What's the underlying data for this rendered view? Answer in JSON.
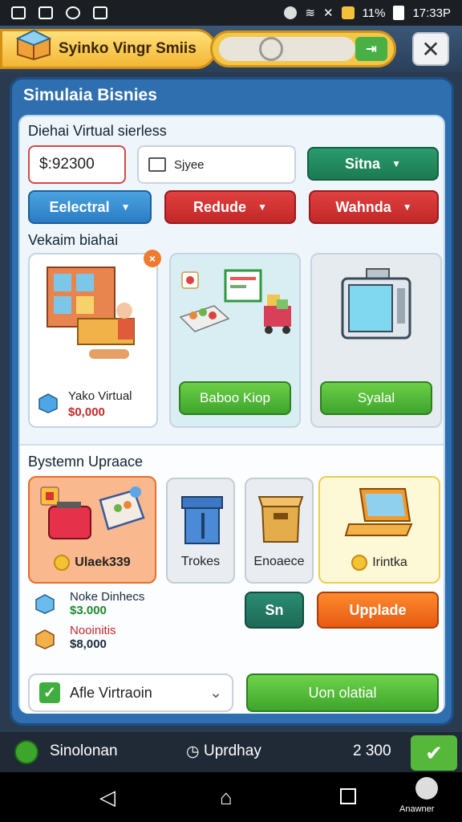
{
  "status_bar": {
    "battery": "11%",
    "time": "17:33P"
  },
  "header": {
    "title": "Syinko Vingr Smiis",
    "close_label": "✕"
  },
  "panel": {
    "title": "Simulaia Bisnies",
    "section1_label": "Diehai Virtual sierless",
    "price_field": "$:92300",
    "search_field": "Sjyee",
    "dropdown_primary": "Sitna",
    "dropdown_blue": "Eelectral",
    "dropdown_red1": "Redude",
    "dropdown_red2": "Wahnda",
    "section2_label": "Vekaim biahai",
    "cards": [
      {
        "name": "Yako Virtual",
        "price": "$0,000"
      },
      {
        "button": "Baboo Kiop"
      },
      {
        "button": "Syalal"
      }
    ],
    "section3_label": "Bystemn Upraace",
    "tiles": [
      {
        "label": "Ulaek339"
      },
      {
        "label": "Trokes"
      },
      {
        "label": "Enoaece"
      },
      {
        "label": "Irintka"
      }
    ],
    "list": [
      {
        "name": "Noke Dinhecs",
        "price": "$3.000"
      },
      {
        "name": "Nooinitis",
        "price": "$8,000"
      }
    ],
    "btn_sn": "Sn",
    "btn_upgrade": "Upplade",
    "bottom_select": "Afle Virtraoin",
    "bottom_action": "Uon olatial"
  },
  "footer": {
    "left": "Sinolonan",
    "center": "Uprdhay",
    "right": "2 300"
  },
  "navbar": {
    "corner": "Anawner"
  }
}
